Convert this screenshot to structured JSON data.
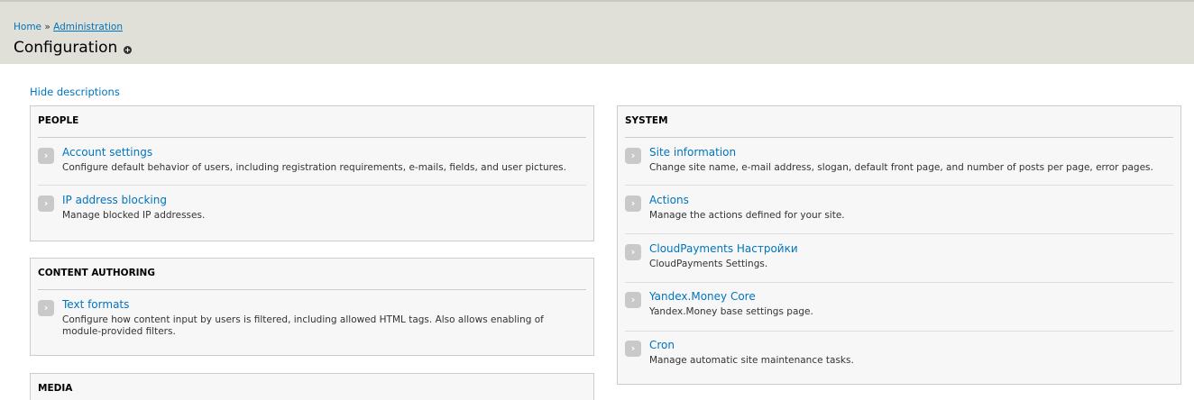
{
  "breadcrumb": {
    "home": "Home",
    "separator": "»",
    "administration": "Administration"
  },
  "page_title": "Configuration",
  "hide_descriptions": "Hide descriptions",
  "left_panels": [
    {
      "title": "PEOPLE",
      "items": [
        {
          "label": "Account settings",
          "description": "Configure default behavior of users, including registration requirements, e-mails, fields, and user pictures."
        },
        {
          "label": "IP address blocking",
          "description": "Manage blocked IP addresses."
        }
      ]
    },
    {
      "title": "CONTENT AUTHORING",
      "items": [
        {
          "label": "Text formats",
          "description": "Configure how content input by users is filtered, including allowed HTML tags. Also allows enabling of module-provided filters."
        }
      ]
    },
    {
      "title": "MEDIA",
      "items": []
    }
  ],
  "system_panel": {
    "title": "SYSTEM",
    "items": [
      {
        "label": "Site information",
        "description": "Change site name, e-mail address, slogan, default front page, and number of posts per page, error pages."
      },
      {
        "label": "Actions",
        "description": "Manage the actions defined for your site."
      },
      {
        "label": "CloudPayments Настройки",
        "description": "CloudPayments Settings."
      },
      {
        "label": "Yandex.Money Core",
        "description": "Yandex.Money base settings page."
      },
      {
        "label": "Cron",
        "description": "Manage automatic site maintenance tasks."
      }
    ]
  },
  "icons": {
    "shortcut": "plus-circle-icon",
    "item_arrow": "chevron-right-icon"
  },
  "colors": {
    "link": "#0074bd",
    "header_bg": "#e0e0d8",
    "panel_bg": "#f7f7f7"
  }
}
